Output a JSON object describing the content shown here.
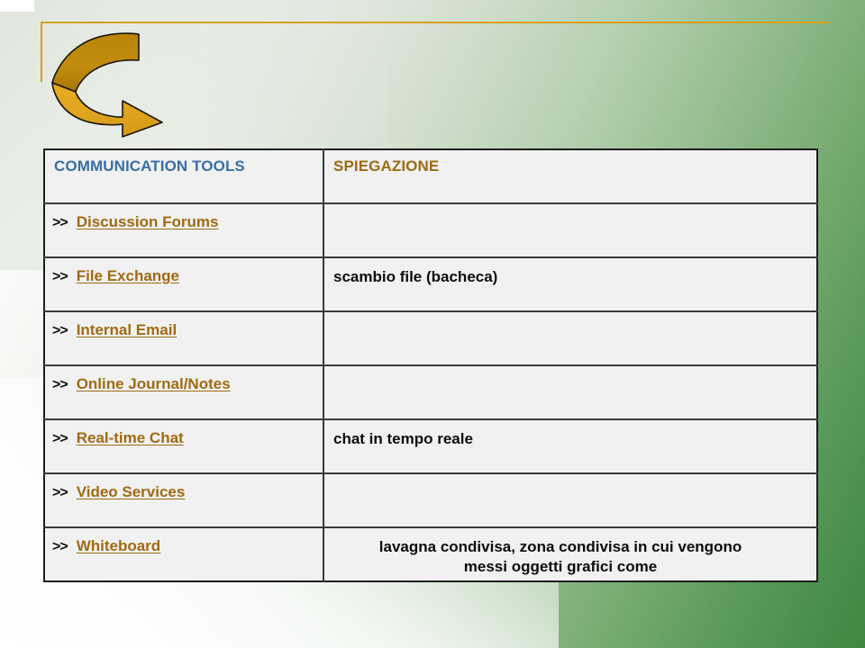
{
  "slide": {
    "background_light": "#ffffff",
    "background_dark": "#3f8742",
    "accent_rule_color": "#d4a11e",
    "arrow_fill_light": "#e0a520",
    "arrow_fill_dark": "#a87608"
  },
  "table": {
    "headers": {
      "tools": "COMMUNICATION TOOLS",
      "explanation": "SPIEGAZIONE",
      "tools_color": "#3a6ea5",
      "explanation_color": "#9c6b12"
    },
    "bullet_marker": ">>",
    "rows": [
      {
        "tool": "Discussion Forums",
        "explanation": ""
      },
      {
        "tool": "File Exchange",
        "explanation": "scambio file (bacheca)"
      },
      {
        "tool": "Internal Email",
        "explanation": ""
      },
      {
        "tool": "Online Journal/Notes",
        "explanation": ""
      },
      {
        "tool": "Real-time Chat",
        "explanation": "chat in tempo reale"
      },
      {
        "tool": "Video Services",
        "explanation": ""
      },
      {
        "tool": "Whiteboard",
        "explanation": "lavagna condivisa, zona condivisa in cui vengono messi oggetti grafici come",
        "explanation_line1": "lavagna condivisa, zona condivisa in cui vengono",
        "explanation_line2": "messi oggetti grafici come"
      }
    ]
  }
}
